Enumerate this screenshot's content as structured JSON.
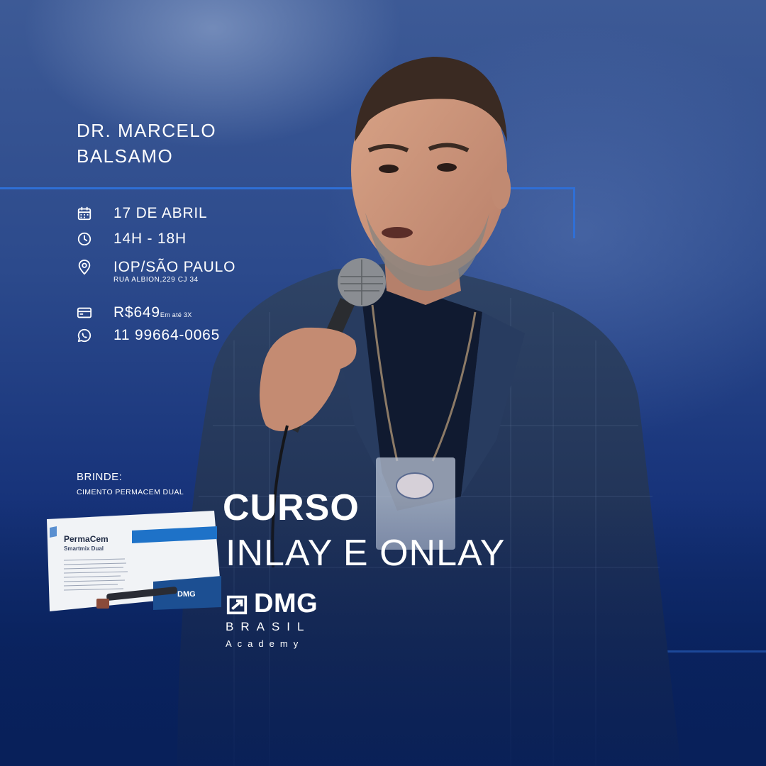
{
  "speaker": {
    "name_line1": "DR. MARCELO",
    "name_line2": "BALSAMO"
  },
  "event": {
    "date": "17 DE ABRIL",
    "time": "14H - 18H",
    "venue": "IOP/SÃO PAULO",
    "address": "RUA ALBION,229 CJ 34",
    "price": "R$649",
    "price_note": "Em até 3X",
    "phone": "11 99664-0065"
  },
  "icons": {
    "date": "calendar-icon",
    "time": "clock-icon",
    "venue": "location-pin-icon",
    "price": "credit-card-icon",
    "phone": "whatsapp-icon"
  },
  "gift": {
    "label": "BRINDE:",
    "item": "CIMENTO PERMACEM DUAL"
  },
  "course": {
    "label": "CURSO",
    "title": "INLAY E ONLAY"
  },
  "brand": {
    "name": "DMG",
    "country": "BRASIL",
    "division": "Academy"
  },
  "product_box": {
    "brand": "PermaCem",
    "variant": "Smartmix Dual",
    "maker": "DMG"
  },
  "colors": {
    "background_top": "#3d5a96",
    "background_bottom": "#08205a",
    "accent_line": "#2f6fd6",
    "text": "#ffffff"
  }
}
